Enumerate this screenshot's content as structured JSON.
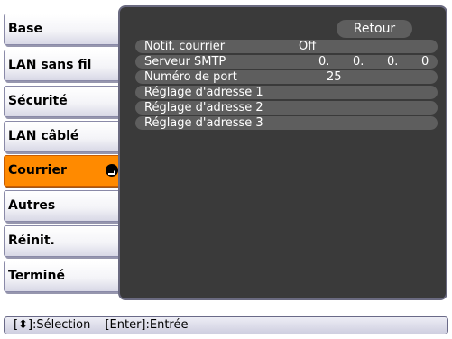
{
  "sidebar": {
    "items": [
      {
        "label": "Base"
      },
      {
        "label": "LAN sans fil"
      },
      {
        "label": "Sécurité"
      },
      {
        "label": "LAN câblé"
      },
      {
        "label": "Courrier",
        "selected": true
      },
      {
        "label": "Autres"
      },
      {
        "label": "Réinit."
      },
      {
        "label": "Terminé"
      }
    ],
    "selected_color": "#ff8a00"
  },
  "panel": {
    "return_label": "Retour",
    "rows": [
      {
        "label": "Notif. courrier",
        "value": "Off"
      },
      {
        "label": "Serveur SMTP",
        "ip": [
          "0.",
          "0.",
          "0.",
          "0"
        ]
      },
      {
        "label": "Numéro de port",
        "value": "25"
      },
      {
        "label": "Réglage d'adresse 1"
      },
      {
        "label": "Réglage d'adresse 2"
      },
      {
        "label": "Réglage d'adresse 3"
      }
    ],
    "background_color": "#3a3a3a",
    "row_color": "#5e5e5e"
  },
  "status_bar": {
    "select_hint": "[⬍]:Sélection",
    "enter_hint": "[Enter]:Entrée"
  },
  "icons": {
    "enter_icon": "enter-icon",
    "updown_icon": "up-down-arrow-icon"
  }
}
